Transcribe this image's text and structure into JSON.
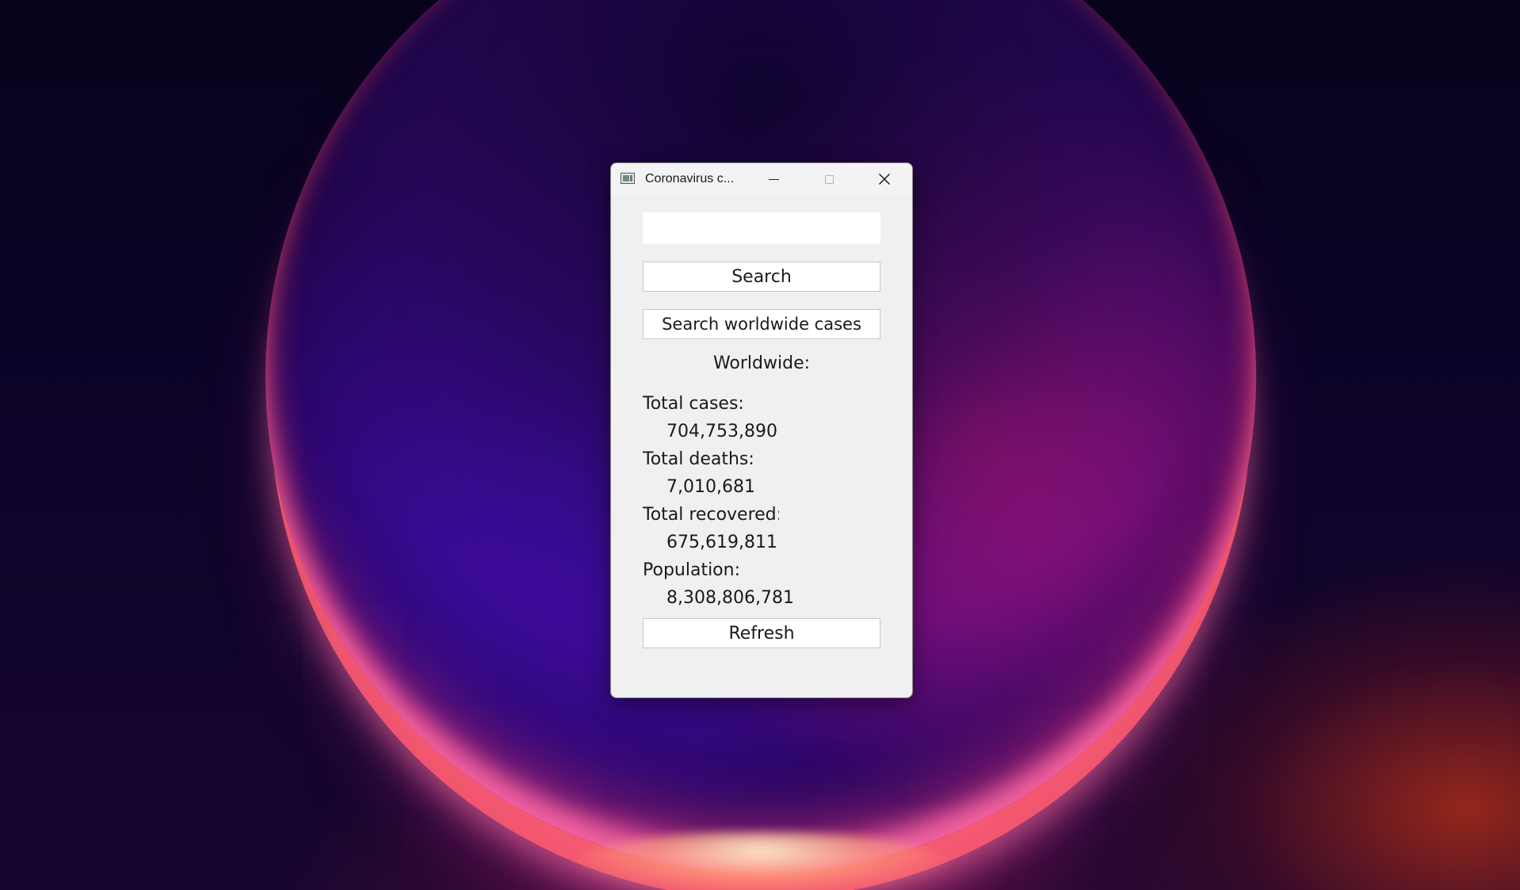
{
  "window": {
    "title": "Coronavirus c..."
  },
  "search": {
    "value": "",
    "placeholder": ""
  },
  "buttons": {
    "search": "Search",
    "worldwide": "Search worldwide cases",
    "refresh": "Refresh"
  },
  "worldwide": {
    "heading": "Worldwide:",
    "stats": [
      {
        "label": "Total cases:",
        "value": "704,753,890"
      },
      {
        "label": "Total deaths:",
        "value": "7,010,681"
      },
      {
        "label": "Total recovered:",
        "value": "675,619,811"
      },
      {
        "label": "Population:",
        "value": "8,308,806,781"
      }
    ]
  },
  "icons": {
    "app": "app-window-icon",
    "minimize": "minimize-icon",
    "maximize": "maximize-icon",
    "close": "close-icon"
  }
}
